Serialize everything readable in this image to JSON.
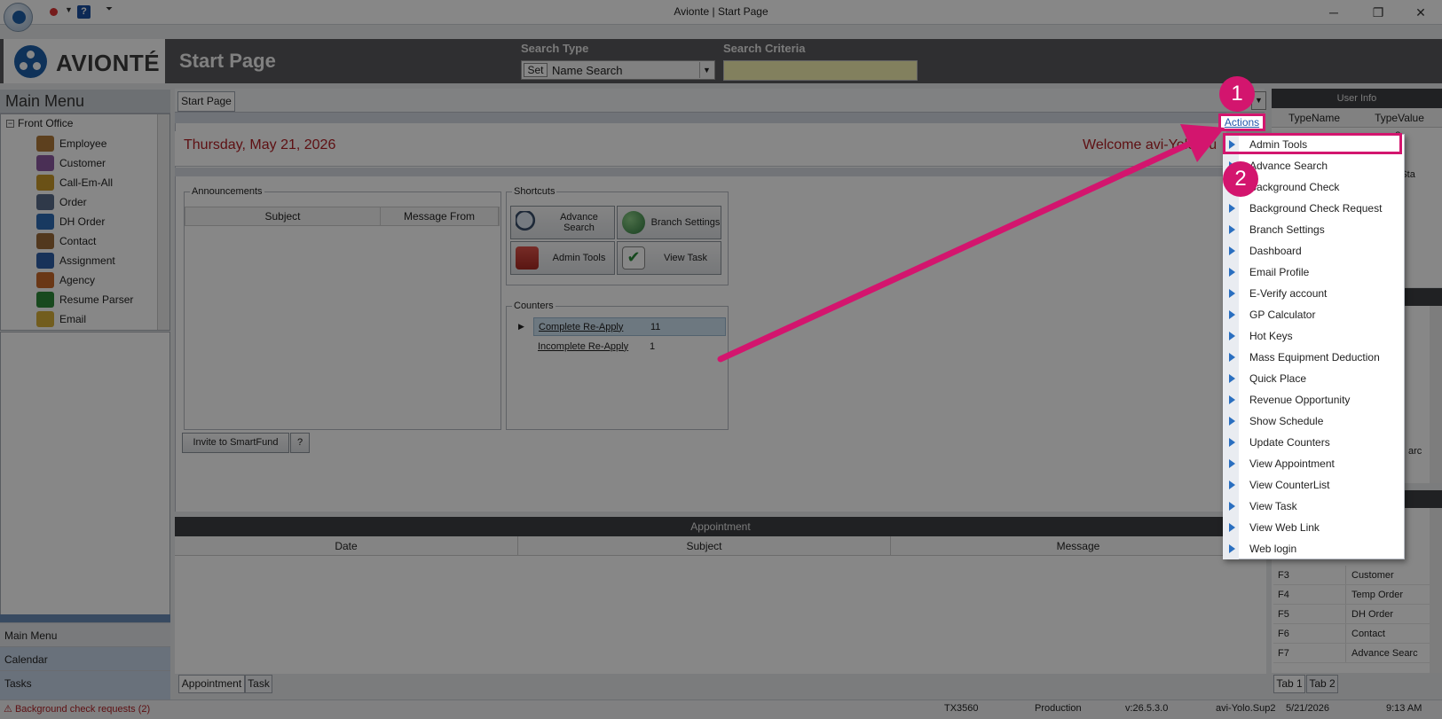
{
  "window": {
    "title": "Avionte | Start Page",
    "help_label": "?",
    "minimize": "─",
    "restore": "❐",
    "close": "✕"
  },
  "header": {
    "logo_text": "AVIONTÉ",
    "page_title": "Start Page",
    "search_type_label": "Search Type",
    "search_criteria_label": "Search Criteria",
    "set_button": "Set",
    "search_type_value": "Name Search",
    "search_criteria_value": ""
  },
  "sidebar": {
    "title": "Main Menu",
    "root": "Front Office",
    "items": [
      {
        "label": "Employee",
        "icon": "employee-icon",
        "color": "#b07a3a"
      },
      {
        "label": "Customer",
        "icon": "customer-icon",
        "color": "#8d5aa0"
      },
      {
        "label": "Call-Em-All",
        "icon": "call-em-all-icon",
        "color": "#c99a2a"
      },
      {
        "label": "Order",
        "icon": "order-icon",
        "color": "#5a6d8a"
      },
      {
        "label": "DH Order",
        "icon": "dh-order-icon",
        "color": "#2e6db5"
      },
      {
        "label": "Contact",
        "icon": "contact-icon",
        "color": "#9c6a3a"
      },
      {
        "label": "Assignment",
        "icon": "assignment-icon",
        "color": "#2e5fa8"
      },
      {
        "label": "Agency",
        "icon": "agency-icon",
        "color": "#c8692a"
      },
      {
        "label": "Resume Parser",
        "icon": "resume-parser-icon",
        "color": "#2f8a3a"
      },
      {
        "label": "Email",
        "icon": "email-icon",
        "color": "#d8b03a"
      }
    ],
    "nav": [
      "Main Menu",
      "Calendar",
      "Tasks"
    ]
  },
  "tabs": {
    "start": "Start Page"
  },
  "start_page": {
    "date": "Thursday, May 21, 2026",
    "welcome": "Welcome avi-Yolo.Su",
    "announcements": {
      "title": "Announcements",
      "columns": [
        "Subject",
        "Message From"
      ]
    },
    "shortcuts": {
      "title": "Shortcuts",
      "items": [
        {
          "label": "Advance Search",
          "icon": "magnifier-icon"
        },
        {
          "label": "Branch Settings",
          "icon": "globe-icon"
        },
        {
          "label": "Admin Tools",
          "icon": "toolbox-icon"
        },
        {
          "label": "View Task",
          "icon": "checklist-icon"
        }
      ]
    },
    "counters": {
      "title": "Counters",
      "rows": [
        {
          "label": "Complete Re-Apply",
          "value": "11"
        },
        {
          "label": "Incomplete Re-Apply",
          "value": "1"
        }
      ]
    },
    "invite_button": "Invite to SmartFund",
    "help_button": "?"
  },
  "appointment": {
    "title": "Appointment",
    "columns": [
      "Date",
      "Subject",
      "Message"
    ],
    "tabs": [
      "Appointment",
      "Task"
    ]
  },
  "right_panel": {
    "user_info_title": "User Info",
    "columns": [
      "TypeName",
      "TypeValue"
    ],
    "value_fragments": [
      "up2",
      "S",
      "nte Sta",
      "n"
    ],
    "hotkey_fragment": "arc",
    "hotkeys": [
      {
        "key": "F3",
        "value": "Customer"
      },
      {
        "key": "F4",
        "value": "Temp Order"
      },
      {
        "key": "F5",
        "value": "DH Order"
      },
      {
        "key": "F6",
        "value": "Contact"
      },
      {
        "key": "F7",
        "value": "Advance Searc"
      }
    ],
    "tabs": [
      "Tab 1",
      "Tab 2"
    ]
  },
  "actions": {
    "label": "Actions",
    "menu": [
      "Admin Tools",
      "Advance Search",
      "Background Check",
      "Background Check Request",
      "Branch Settings",
      "Dashboard",
      "Email Profile",
      "E-Verify account",
      "GP Calculator",
      "Hot Keys",
      "Mass Equipment Deduction",
      "Quick Place",
      "Revenue Opportunity",
      "Show Schedule",
      "Update Counters",
      "View Appointment",
      "View CounterList",
      "View Task",
      "View Web Link",
      "Web login"
    ]
  },
  "status_bar": {
    "alert": "Background check requests (2)",
    "code": "TX3560",
    "environment": "Production",
    "version": "v:26.5.3.0",
    "user": "avi-Yolo.Sup2",
    "date": "5/21/2026",
    "time": "9:13 AM"
  },
  "callouts": [
    "1",
    "2"
  ],
  "colors": {
    "accent": "#d3156e",
    "brand": "#1d5fa8",
    "date_red": "#b11f24"
  }
}
